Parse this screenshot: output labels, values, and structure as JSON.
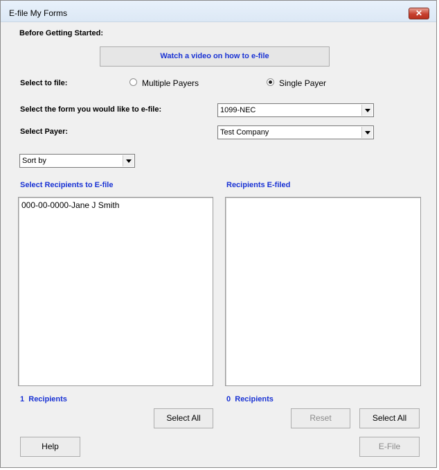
{
  "window": {
    "title": "E-file My Forms",
    "close_label": "✕"
  },
  "before": {
    "label": "Before Getting Started:",
    "video_button": "Watch a video on how to e-file"
  },
  "file_select": {
    "label": "Select to file:",
    "options": [
      {
        "label": "Multiple Payers",
        "selected": false
      },
      {
        "label": "Single Payer",
        "selected": true
      }
    ]
  },
  "form_select": {
    "label": "Select the form you would like to e-file:",
    "value": "1099-NEC"
  },
  "payer_select": {
    "label": "Select Payer:",
    "value": "Test Company"
  },
  "sort": {
    "value": "Sort by"
  },
  "left_panel": {
    "header": "Select Recipients to E-file",
    "items": [
      "000-00-0000-Jane J Smith"
    ],
    "count": "1",
    "count_label": "Recipients",
    "select_all": "Select All"
  },
  "right_panel": {
    "header": "Recipients E-filed",
    "items": [],
    "count": "0",
    "count_label": "Recipients",
    "reset": "Reset",
    "select_all": "Select All"
  },
  "footer": {
    "help": "Help",
    "efile": "E-File"
  },
  "colors": {
    "accent_text": "#1a33d4",
    "window_bg": "#f0f0f0",
    "close_red": "#c7402f"
  }
}
